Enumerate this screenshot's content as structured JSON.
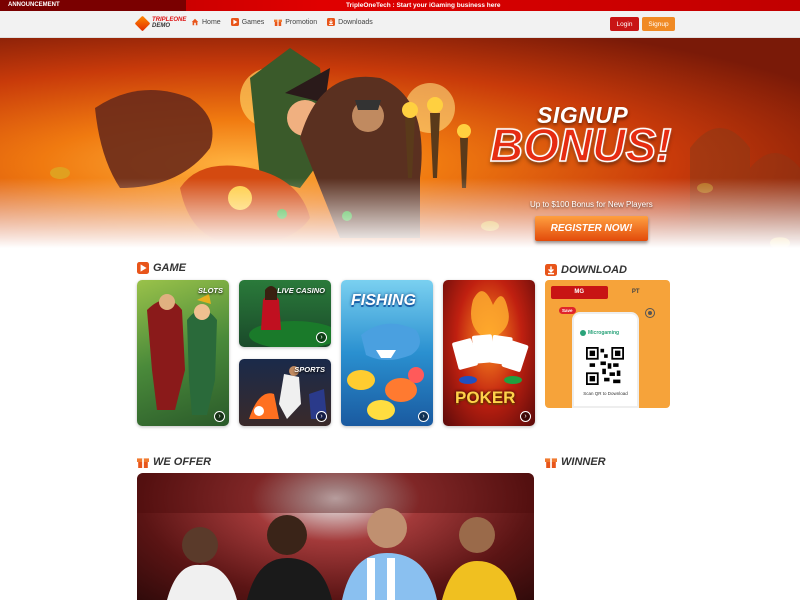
{
  "announcement": {
    "label": "ANNOUNCEMENT",
    "text": "TripleOneTech : Start your iGaming business here"
  },
  "header": {
    "logo_line1": "TRIPLEONE",
    "logo_line2": "DEMO",
    "nav": [
      {
        "label": "Home",
        "icon": "home-icon"
      },
      {
        "label": "Games",
        "icon": "games-icon"
      },
      {
        "label": "Promotion",
        "icon": "gift-icon"
      },
      {
        "label": "Downloads",
        "icon": "download-icon"
      }
    ],
    "login_label": "Login",
    "signup_label": "Signup"
  },
  "hero": {
    "signup": "SIGNUP",
    "bonus": "BONUS!",
    "subtitle": "Up to $100 Bonus for New Players",
    "register_label": "REGISTER NOW!"
  },
  "sections": {
    "game_title": "GAME",
    "download_title": "DOWNLOAD",
    "offer_title": "WE OFFER",
    "winner_title": "WINNER"
  },
  "games": {
    "slots": "SLOTS",
    "live_casino": "LIVE CASINO",
    "fishing": "FISHING",
    "sports": "SPORTS",
    "poker": "POKER"
  },
  "download": {
    "tab_active": "MG",
    "tab_inactive": "PT",
    "save_label": "Save",
    "brand": "Microgaming",
    "caption": "Scan QR to Download"
  },
  "colors": {
    "brand_red": "#c81414",
    "brand_orange": "#f08a24",
    "download_panel": "#f6a33a"
  }
}
